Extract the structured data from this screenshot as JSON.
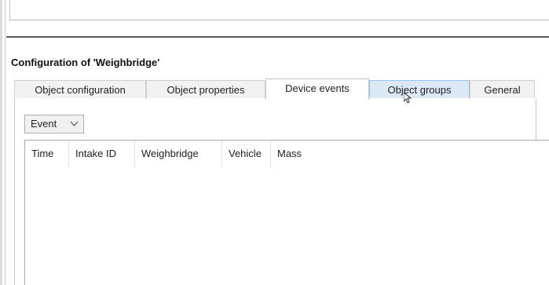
{
  "config": {
    "title": "Configuration of 'Weighbridge'"
  },
  "tabs": [
    {
      "label": "Object configuration"
    },
    {
      "label": "Object properties"
    },
    {
      "label": "Device events",
      "active": true
    },
    {
      "label": "Object groups",
      "hover": true
    },
    {
      "label": "General"
    }
  ],
  "event_filter": {
    "selected": "Event",
    "icon": "chevron-down-icon"
  },
  "table": {
    "columns": [
      "Time",
      "Intake ID",
      "Weighbridge",
      "Vehicle",
      "Mass"
    ],
    "rows": []
  },
  "colors": {
    "tab_hover": "#dbe9f6",
    "tab_active": "#ffffff",
    "tab_inactive": "#f2f2f2"
  }
}
